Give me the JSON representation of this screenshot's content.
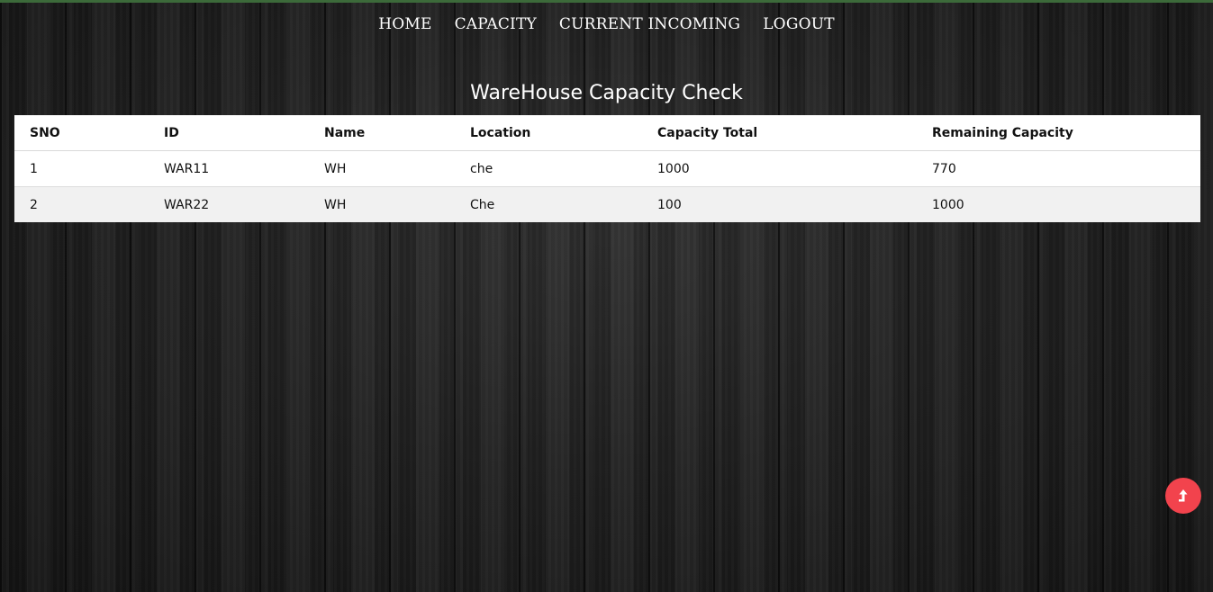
{
  "nav": {
    "items": [
      {
        "label": "HOME"
      },
      {
        "label": "CAPACITY"
      },
      {
        "label": "CURRENT INCOMING"
      },
      {
        "label": "LOGOUT"
      }
    ]
  },
  "page": {
    "title": "WareHouse Capacity Check"
  },
  "table": {
    "headers": [
      "SNO",
      "ID",
      "Name",
      "Location",
      "Capacity Total",
      "Remaining Capacity"
    ],
    "rows": [
      [
        "1",
        "WAR11",
        "WH",
        "che",
        "1000",
        "770"
      ],
      [
        "2",
        "WAR22",
        "WH",
        "Che",
        "100",
        "1000"
      ]
    ]
  },
  "scroll_top_button": {
    "icon": "arrow-up-icon",
    "color": "#f2434d"
  },
  "colors": {
    "top_strip": "#3c6a3a",
    "table_alt_row": "#f1f1f1"
  }
}
